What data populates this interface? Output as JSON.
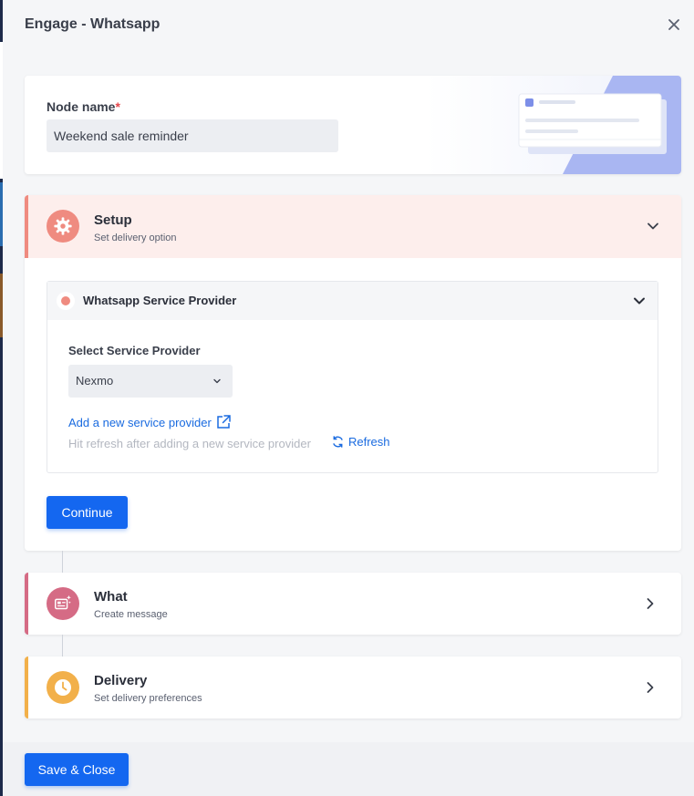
{
  "header": {
    "title": "Engage - Whatsapp"
  },
  "node": {
    "label": "Node name",
    "required_mark": "*",
    "value": "Weekend sale reminder"
  },
  "setup": {
    "title": "Setup",
    "subtitle": "Set delivery option",
    "provider_section": {
      "title": "Whatsapp Service Provider",
      "select_label": "Select Service Provider",
      "selected_value": "Nexmo",
      "add_link": "Add a new service provider",
      "hint": "Hit refresh after adding a new service provider",
      "refresh_label": "Refresh"
    },
    "continue_label": "Continue"
  },
  "what": {
    "title": "What",
    "subtitle": "Create message"
  },
  "delivery": {
    "title": "Delivery",
    "subtitle": "Set delivery preferences"
  },
  "footer": {
    "save_label": "Save & Close"
  },
  "colors": {
    "primary": "#1467f0",
    "setup_accent": "#ef8b80",
    "what_accent": "#d56b85",
    "delivery_accent": "#f2b04a"
  },
  "icons": {
    "close": "close-icon",
    "setup": "gear-icon",
    "what": "message-template-icon",
    "delivery": "clock-icon",
    "expand": "chevron-down-icon",
    "collapse_right": "chevron-right-icon",
    "external": "external-link-icon",
    "refresh": "refresh-icon"
  }
}
